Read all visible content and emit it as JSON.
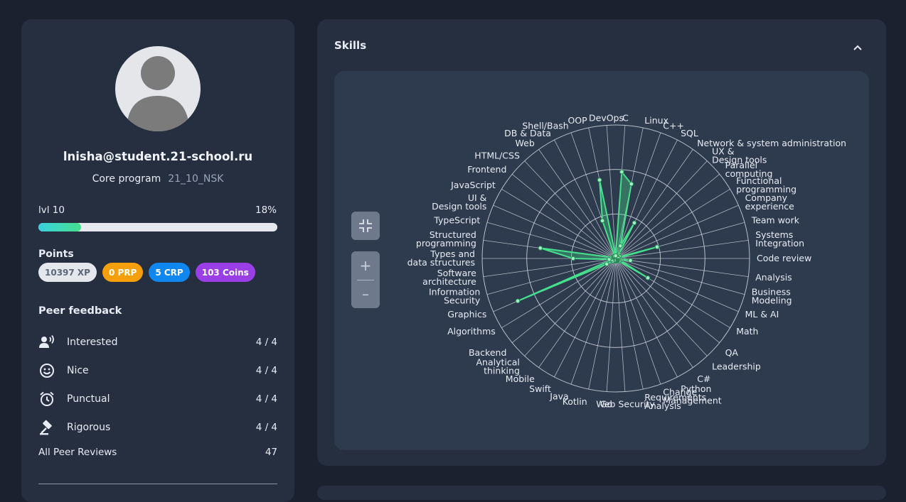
{
  "profile": {
    "login": "lnisha@student.21-school.ru",
    "program": "Core program",
    "wave": "21_10_NSK",
    "level": "lvl 10",
    "progress_label": "18%",
    "progress": 0.18
  },
  "points": {
    "title": "Points",
    "xp": "10397 XP",
    "prp": "0 PRP",
    "crp": "5 CRP",
    "coins": "103 Coins"
  },
  "feedback": {
    "title": "Peer feedback",
    "items": [
      {
        "label": "Interested",
        "value": "4 / 4",
        "icon": "person-speaking-icon"
      },
      {
        "label": "Nice",
        "value": "4 / 4",
        "icon": "smile-icon"
      },
      {
        "label": "Punctual",
        "value": "4 / 4",
        "icon": "alarm-clock-icon"
      },
      {
        "label": "Rigorous",
        "value": "4 / 4",
        "icon": "gavel-icon"
      }
    ],
    "all_reviews_label": "All Peer Reviews",
    "all_reviews_value": "47"
  },
  "skills": {
    "title": "Skills",
    "zoom_in": "+",
    "zoom_out": "–"
  },
  "colors": {
    "accent": "#45e08c",
    "card": "#252f40",
    "background": "#1a222f"
  },
  "chart_data": {
    "type": "radar",
    "max": 1.0,
    "skills": [
      {
        "name": "C",
        "value": 0.65
      },
      {
        "name": "Linux",
        "value": 0.57
      },
      {
        "name": "C++",
        "value": 0.1
      },
      {
        "name": "SQL",
        "value": 0.3
      },
      {
        "name": "Network & system administration",
        "value": 0.04
      },
      {
        "name": "UX & Design tools",
        "value": 0.03
      },
      {
        "name": "Parallel computing",
        "value": 0.02
      },
      {
        "name": "Functional programming",
        "value": 0.02
      },
      {
        "name": "Company experience",
        "value": 0.03
      },
      {
        "name": "Team work",
        "value": 0.32
      },
      {
        "name": "Systems Integration",
        "value": 0.02
      },
      {
        "name": "Code review",
        "value": 0.02
      },
      {
        "name": "Analysis",
        "value": 0.11
      },
      {
        "name": "Business Modeling",
        "value": 0.04
      },
      {
        "name": "ML & AI",
        "value": 0.03
      },
      {
        "name": "Math",
        "value": 0.28
      },
      {
        "name": "QA",
        "value": 0.03
      },
      {
        "name": "Leadership",
        "value": 0.02
      },
      {
        "name": "C#",
        "value": 0.02
      },
      {
        "name": "Python",
        "value": 0.02
      },
      {
        "name": "Change Management",
        "value": 0.02
      },
      {
        "name": "Requirements Analysis",
        "value": 0.02
      },
      {
        "name": "Web Security",
        "value": 0.02
      },
      {
        "name": "Go",
        "value": 0.02
      },
      {
        "name": "Kotlin",
        "value": 0.02
      },
      {
        "name": "Java",
        "value": 0.02
      },
      {
        "name": "Swift",
        "value": 0.02
      },
      {
        "name": "Mobile",
        "value": 0.02
      },
      {
        "name": "Analytical thinking",
        "value": 0.03
      },
      {
        "name": "Backend",
        "value": 0.03
      },
      {
        "name": "Algorithms",
        "value": 0.08
      },
      {
        "name": "Graphics",
        "value": 0.8
      },
      {
        "name": "Information Security",
        "value": 0.03
      },
      {
        "name": "Software architecture",
        "value": 0.05
      },
      {
        "name": "Types and data structures",
        "value": 0.32
      },
      {
        "name": "Structured programming",
        "value": 0.57
      },
      {
        "name": "TypeScript",
        "value": 0.03
      },
      {
        "name": "UI & Design tools",
        "value": 0.02
      },
      {
        "name": "JavaScript",
        "value": 0.02
      },
      {
        "name": "Frontend",
        "value": 0.02
      },
      {
        "name": "HTML/CSS",
        "value": 0.02
      },
      {
        "name": "Web",
        "value": 0.02
      },
      {
        "name": "DB & Data",
        "value": 0.02
      },
      {
        "name": "Shell/Bash",
        "value": 0.3
      },
      {
        "name": "OOP",
        "value": 0.6
      },
      {
        "name": "DevOps",
        "value": 0.02
      }
    ]
  }
}
